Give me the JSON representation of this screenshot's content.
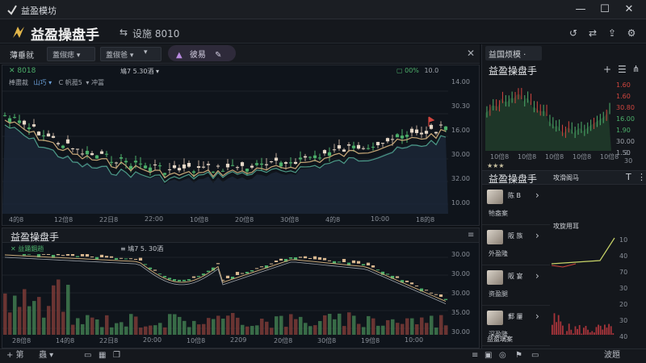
{
  "window": {
    "title": "益盈模坊"
  },
  "app": {
    "brand": "益盈操盘手",
    "subtitle": "设施 8010"
  },
  "toolbar": {
    "label": "薄垂就",
    "dropdown1": "蓋俶痣 ▾",
    "dropdown2": "蓋俶爸 ▾",
    "dropdown3": "▾",
    "pill_label": "彼易"
  },
  "chart_top": {
    "legend_symbol": "8018",
    "legend_line2_a": "棒盡裁",
    "legend_line2_b": "山巧 ▾",
    "legend_line2_c": "C 帆菰5",
    "legend_line2_d": "▾ 冲冨",
    "timeframe": "鳩7 5.30酒 ▾",
    "pct": "00%",
    "pct2": "10.0",
    "y_ticks": [
      "14.00",
      "30.30",
      "16.00",
      "30.00",
      "32.00",
      "10.00"
    ],
    "x_ticks": [
      "4的8",
      "12倍8",
      "22日8",
      "22:00",
      "10倍8",
      "20倍8",
      "30倍8",
      "4的8",
      "10:00",
      "18的8"
    ]
  },
  "chart_bottom": {
    "title": "益盈操盘手",
    "legend": "益踊錮趟",
    "timeframe": "鳩7 5. 30酒",
    "y_ticks": [
      "30.00",
      "30.00",
      "30.00",
      "35.00",
      "30.00"
    ],
    "x_ticks": [
      "28倍8",
      "14的8",
      "22日8",
      "20:00",
      "10倍8",
      "2209",
      "20倍8",
      "30倍8",
      "19倍8",
      "10:00"
    ]
  },
  "sidebar": {
    "tab": "益国烦模 ·",
    "header": "益盈操盘手",
    "mini_y": [
      "1.60",
      "1.60",
      "30.80",
      "16.00",
      "1.90",
      "30.00",
      "1.50"
    ],
    "mini_legend": [
      "2:",
      "30"
    ],
    "mini_x": [
      "10倍8",
      "10倍8",
      "10倍8",
      "10倍8",
      "10倍8"
    ],
    "section_star": "★★★",
    "list_header": "益盈操盘手",
    "list_header2": "攻滑阁马",
    "items": [
      {
        "name": "陈 B",
        "sub": "牠盎案"
      },
      {
        "name": "阪 族",
        "sub": "外盈隆"
      },
      {
        "name": "阪 宴",
        "sub": "资盈腿"
      },
      {
        "name": "郵 屢",
        "sub": "深盈隆"
      }
    ],
    "panel2_title": "攻旋用耳",
    "panel2_y": [
      "10",
      "40",
      "70",
      "30",
      "20",
      "30",
      "40"
    ],
    "footer_item": "益盈璃案"
  },
  "statusbar": {
    "left_items": [
      "+ 第",
      "蟲 ▾"
    ],
    "right_label": "波題"
  },
  "colors": {
    "up": "#4caf6a",
    "down": "#d0453e",
    "accent": "#c8d468"
  }
}
